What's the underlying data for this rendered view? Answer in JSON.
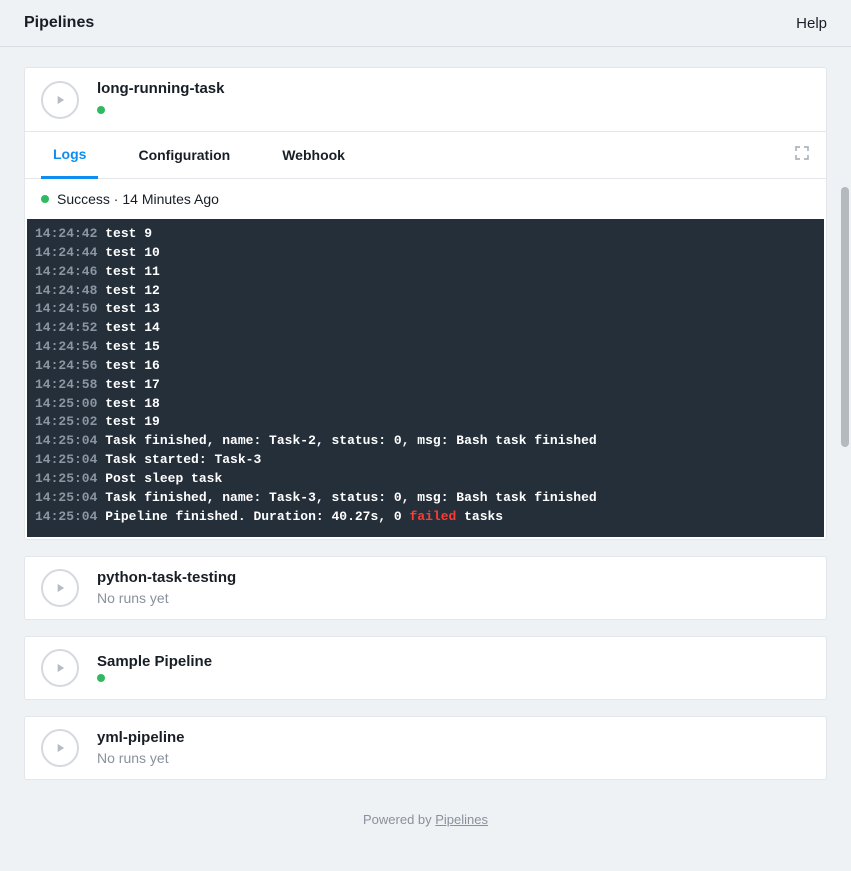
{
  "topbar": {
    "title": "Pipelines",
    "help": "Help"
  },
  "expanded": {
    "name": "long-running-task",
    "tabs": {
      "logs": "Logs",
      "configuration": "Configuration",
      "webhook": "Webhook"
    },
    "status": {
      "label": "Success",
      "time": "14 Minutes Ago"
    },
    "logs": [
      {
        "ts": "14:24:42",
        "msg": "test 9"
      },
      {
        "ts": "14:24:44",
        "msg": "test 10"
      },
      {
        "ts": "14:24:46",
        "msg": "test 11"
      },
      {
        "ts": "14:24:48",
        "msg": "test 12"
      },
      {
        "ts": "14:24:50",
        "msg": "test 13"
      },
      {
        "ts": "14:24:52",
        "msg": "test 14"
      },
      {
        "ts": "14:24:54",
        "msg": "test 15"
      },
      {
        "ts": "14:24:56",
        "msg": "test 16"
      },
      {
        "ts": "14:24:58",
        "msg": "test 17"
      },
      {
        "ts": "14:25:00",
        "msg": "test 18"
      },
      {
        "ts": "14:25:02",
        "msg": "test 19"
      },
      {
        "ts": "14:25:04",
        "msg": "Task finished, name: Task-2, status: 0, msg: Bash task finished"
      },
      {
        "ts": "14:25:04",
        "msg": "Task started: Task-3"
      },
      {
        "ts": "14:25:04",
        "msg": "Post sleep task"
      },
      {
        "ts": "14:25:04",
        "msg": "Task finished, name: Task-3, status: 0, msg: Bash task finished"
      },
      {
        "ts": "14:25:04",
        "pre": "Pipeline finished. Duration: 40.27s, 0 ",
        "failed": "failed",
        "post": " tasks"
      }
    ]
  },
  "pipelines": [
    {
      "name": "python-task-testing",
      "sub": "No runs yet",
      "dot": false
    },
    {
      "name": "Sample Pipeline",
      "sub": "",
      "dot": true
    },
    {
      "name": "yml-pipeline",
      "sub": "No runs yet",
      "dot": false
    }
  ],
  "footer": {
    "powered": "Powered by ",
    "link": "Pipelines"
  }
}
